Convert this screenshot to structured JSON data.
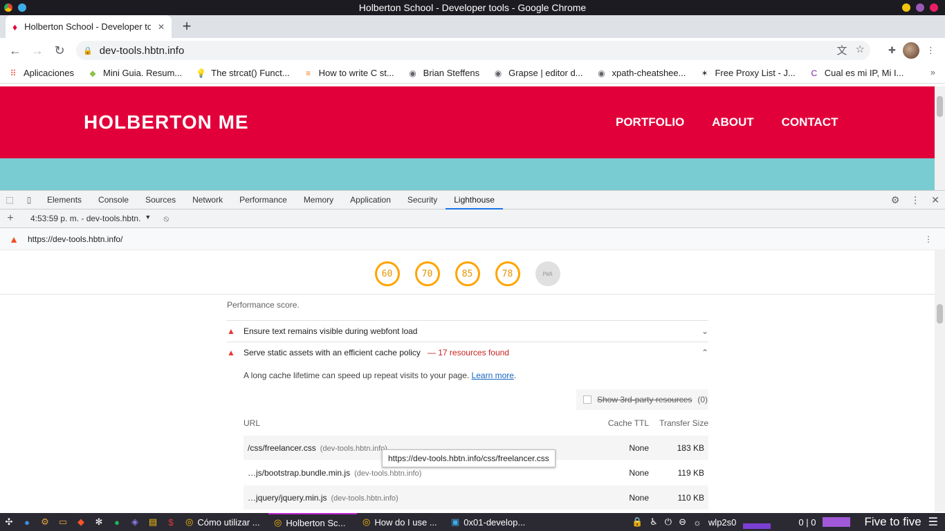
{
  "window_title": "Holberton School - Developer tools - Google Chrome",
  "tab": {
    "title": "Holberton School - Developer tools",
    "close": "✕"
  },
  "address": {
    "url": "dev-tools.hbtn.info"
  },
  "bookmarks": [
    {
      "label": "Aplicaciones",
      "icon": "apps-grid-icon"
    },
    {
      "label": "Mini Guia. Resum...",
      "icon": "diamond-icon"
    },
    {
      "label": "The strcat() Funct...",
      "icon": "bulb-icon"
    },
    {
      "label": "How to write C st...",
      "icon": "stackoverflow-icon"
    },
    {
      "label": "Brian Steffens",
      "icon": "globe-icon"
    },
    {
      "label": "Grapse | editor d...",
      "icon": "globe-icon"
    },
    {
      "label": "xpath-cheatshee...",
      "icon": "globe-icon"
    },
    {
      "label": "Free Proxy List - J...",
      "icon": "spider-icon"
    },
    {
      "label": "Cual es mi IP, Mi I...",
      "icon": "cip-icon"
    }
  ],
  "site": {
    "logo": "HOLBERTON ME",
    "nav": [
      "PORTFOLIO",
      "ABOUT",
      "CONTACT"
    ],
    "colors": {
      "header": "#e2003b",
      "band": "#79ccd1"
    }
  },
  "devtools": {
    "tabs": [
      "Elements",
      "Console",
      "Sources",
      "Network",
      "Performance",
      "Memory",
      "Application",
      "Security",
      "Lighthouse"
    ],
    "active_tab": "Lighthouse",
    "report_select": "4:53:59 p. m. - dev-tools.hbtn.",
    "report_url": "https://dev-tools.hbtn.info/"
  },
  "scores": [
    "60",
    "70",
    "85",
    "78",
    "PWA"
  ],
  "report": {
    "perf_note": "Performance score.",
    "audits": [
      {
        "title": "Ensure text remains visible during webfont load",
        "detail": ""
      },
      {
        "title": "Serve static assets with an efficient cache policy",
        "detail": "— 17 resources found"
      }
    ],
    "description": "A long cache lifetime can speed up repeat visits to your page.",
    "learn_more": "Learn more",
    "third_party": {
      "label": "Show 3rd-party resources",
      "count": "(0)"
    },
    "headers": {
      "url": "URL",
      "ttl": "Cache TTL",
      "size": "Transfer Size"
    },
    "rows": [
      {
        "url": "/css/freelancer.css",
        "host": "(dev-tools.hbtn.info)",
        "ttl": "None",
        "size": "183 KB"
      },
      {
        "url": "…js/bootstrap.bundle.min.js",
        "host": "(dev-tools.hbtn.info)",
        "ttl": "None",
        "size": "119 KB"
      },
      {
        "url": "…jquery/jquery.min.js",
        "host": "(dev-tools.hbtn.info)",
        "ttl": "None",
        "size": "110 KB"
      }
    ],
    "tooltip": "https://dev-tools.hbtn.info/css/freelancer.css"
  },
  "taskbar": {
    "tasks": [
      "Cómo utilizar ...",
      "Holberton Sc...",
      "How do I use ...",
      "0x01-develop..."
    ],
    "network": "wlp2s0",
    "traffic": "0 | 0",
    "clock": "Five to five"
  }
}
